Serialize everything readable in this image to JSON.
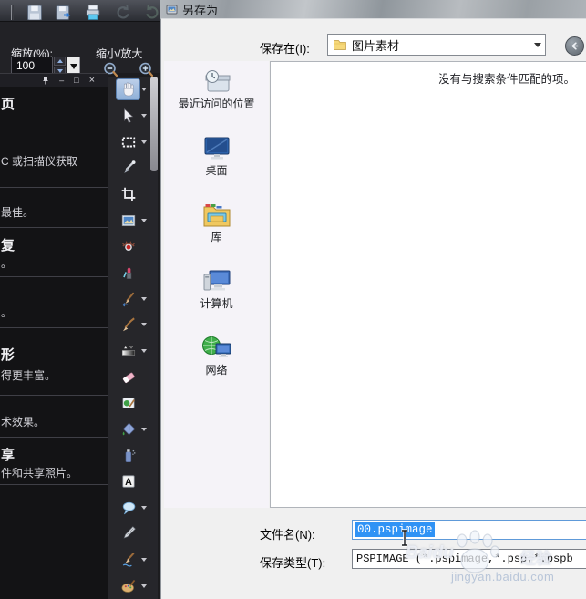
{
  "app": {
    "zoom": {
      "label": "缩放(%):",
      "value": "100",
      "range_label": "缩小/放大"
    },
    "panel": {
      "controls": {
        "minimize": "–",
        "maximize": "□",
        "close": "×"
      },
      "items": [
        {
          "heading": "页",
          "body": ""
        },
        {
          "heading": "",
          "body": "C 或扫描仪获取"
        },
        {
          "heading": "",
          "body": "最佳。"
        },
        {
          "heading": "复",
          "body": "。"
        },
        {
          "heading": "",
          "body": "。"
        },
        {
          "heading": "形",
          "body": "得更丰富。"
        },
        {
          "heading": "",
          "body": "术效果。"
        },
        {
          "heading": "享",
          "body": "件和共享照片。"
        }
      ]
    }
  },
  "dialog": {
    "title": "另存为",
    "save_in_label": "保存在(I):",
    "current_folder": "图片素材",
    "empty_message": "没有与搜索条件匹配的项。",
    "places": [
      {
        "label": "最近访问的位置"
      },
      {
        "label": "桌面"
      },
      {
        "label": "库"
      },
      {
        "label": "计算机"
      },
      {
        "label": "网络"
      }
    ],
    "filename_label": "文件名(N):",
    "filename_value": "00.pspimage",
    "filetype_label": "保存类型(T):",
    "filetype_value": "PSPIMAGE (*.pspimage,*.psp,*.pspb"
  },
  "watermark": {
    "brand": "Baidu",
    "brand_cn": "经验",
    "url": "jingyan.baidu.com"
  },
  "icons": {
    "spin-up": "triangle-up",
    "spin-down": "triangle-down",
    "preset-dropdown": "black-triangle-down",
    "tool-flyout": "small-triangle-down",
    "zoom-out": "magnifier-minus",
    "zoom-in": "magnifier-plus",
    "back-button": "circle-left-arrow",
    "folder": "yellow-folder",
    "combo-caret": "triangle-down"
  },
  "colors": {
    "selection_blue": "#3093f5",
    "app_dark": "#1c1c1f",
    "dialog_bg": "#f0f0f0",
    "places_bg": "#f5f3f8"
  }
}
